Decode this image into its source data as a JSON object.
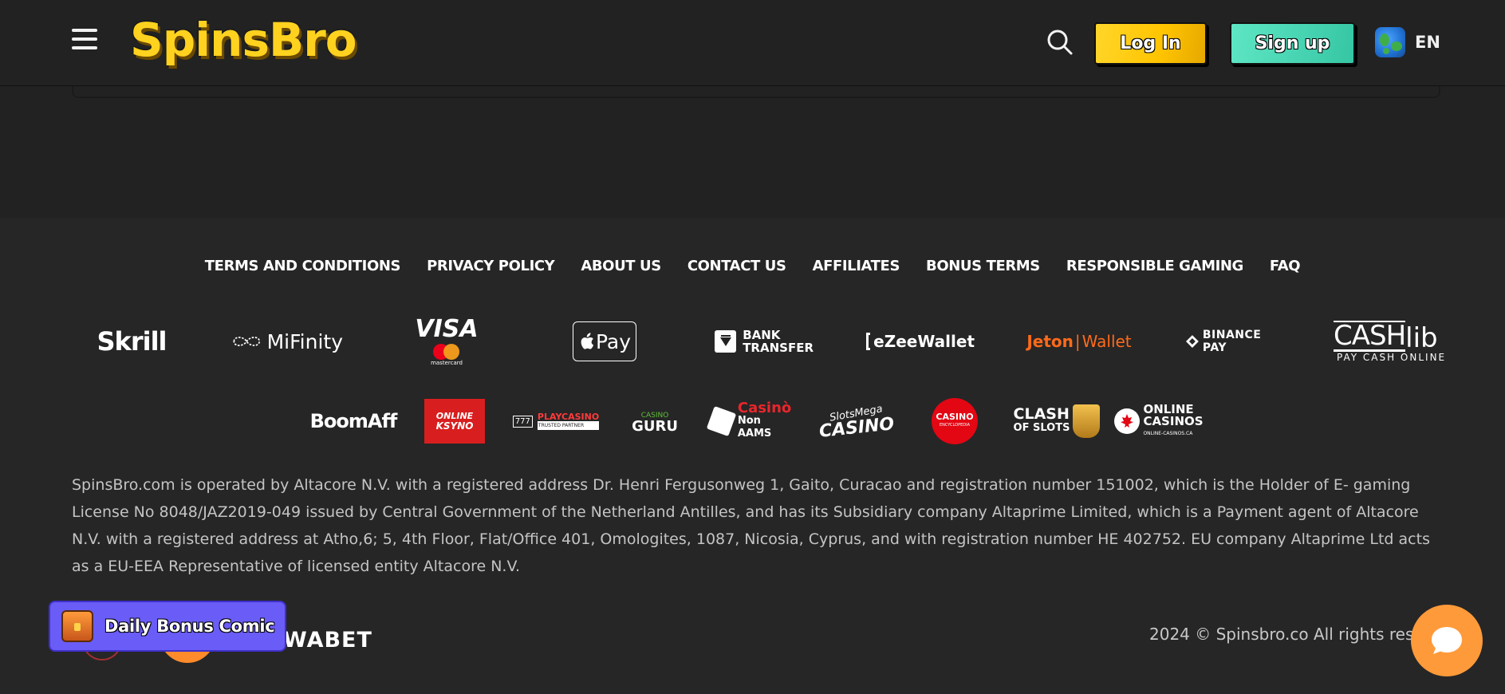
{
  "header": {
    "logo_text": "SpinsBro",
    "login_label": "Log In",
    "signup_label": "Sign up",
    "language_code": "EN"
  },
  "footer": {
    "nav": [
      "TERMS AND CONDITIONS",
      "PRIVACY POLICY",
      "ABOUT US",
      "CONTACT US",
      "AFFILIATES",
      "BONUS TERMS",
      "RESPONSIBLE GAMING",
      "FAQ"
    ],
    "payments": {
      "skrill": "Skrill",
      "mifinity": "MiFinity",
      "visa": "VISA",
      "mastercard": "mastercard",
      "applepay": "Pay",
      "bank_line1": "BANK",
      "bank_line2": "TRANSFER",
      "ezeewallet": "eZeeWallet",
      "jeton_a": "Jeton",
      "jeton_b": "Wallet",
      "binance": "BINANCE PAY",
      "cashlib_a": "CASH",
      "cashlib_b": "lib",
      "cashlib_sub": "PAY CASH ONLINE"
    },
    "partners": {
      "boomaff": "BoomAff",
      "ksyno_a": "ONLINE",
      "ksyno_b": "KSYNO",
      "playcasino_a": "PLAYCASINO",
      "playcasino_b": "TRUSTED PARTNER",
      "guru_a": "CASINO",
      "guru_b": "GURU",
      "nonaams_a": "Casinò",
      "nonaams_b": "Non AAMS",
      "slotsmega_a": "SlotsMega",
      "slotsmega_b": "CASINO",
      "encyclopedia_a": "CASINO",
      "encyclopedia_b": "ENCYCLOPEDIA",
      "clash_a": "CLASH",
      "clash_b": "OF SLOTS",
      "onlinecasinos_a": "ONLINE",
      "onlinecasinos_b": "CASINOS",
      "onlinecasinos_c": "ONLINE-CASINOS.CA"
    },
    "legal_text": "SpinsBro.com is operated by Altacore N.V. with a registered address Dr. Henri Fergusonweg 1, Gaito, Curacao and registration number 151002, which is the Holder of E- gaming License No 8048/JAZ2019-049 issued by Central Government of the Netherland Antilles, and has its Subsidiary company Altaprime Limited, which is a Payment agent of Altacore N.V. with a registered address at Atho,6; 5, 4th Floor, Flat/Office 401, Omologites, 1087, Nicosia, Cyprus, and with registration number HE 402752. EU company Altaprime Ltd acts as a EU-EEA Representative of licensed entity Altacore N.V.",
    "copyright": "2024 © Spinsbro.co All rights reserv",
    "wabet": "WABET"
  },
  "floating": {
    "daily_bonus_label": "Daily Bonus Comic"
  },
  "colors": {
    "page_bg": "#222222",
    "logo_yellow": "#ffd21f",
    "login_yellow": "#ffc400",
    "signup_teal": "#36c6a4",
    "daily_purple": "#6a5cf6",
    "chat_orange": "#ff9a3a",
    "jeton_orange": "#ff6a1a"
  },
  "icons": [
    "hamburger-icon",
    "search-icon",
    "globe-icon",
    "chest-icon",
    "chat-icon"
  ]
}
